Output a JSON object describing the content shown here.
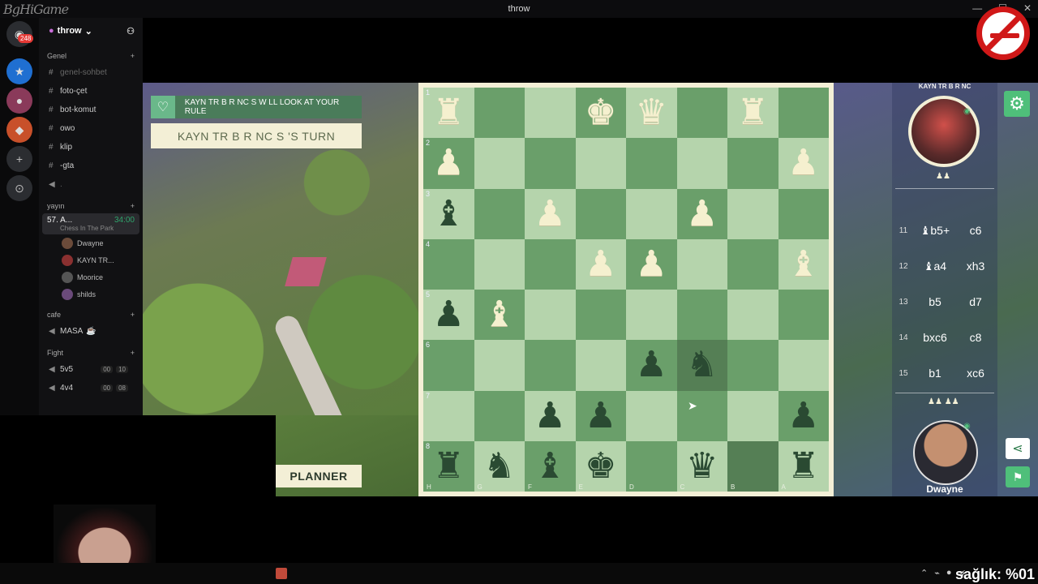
{
  "window": {
    "title": "throw",
    "overlay_logo": "BgHiGame",
    "health_text": "sağlık: %01"
  },
  "rail": {
    "badge": "248"
  },
  "server": {
    "name": "throw",
    "categories": {
      "genel": "Genel",
      "yayin": "yayın",
      "cafe": "cafe",
      "fight": "Fight"
    },
    "text_channels": [
      "genel-sohbet",
      "foto-çet",
      "bot-komut",
      "owo",
      "klip",
      "-gta"
    ],
    "voice_active": {
      "name": "57. A...",
      "timer": "34:00",
      "activity": "Chess In The Park"
    },
    "voice_users": [
      "Dwayne",
      "KAYN TR...",
      "Moorice",
      "shilds"
    ],
    "cafe_channels": [
      "MASA"
    ],
    "fight_channels": [
      {
        "name": "5v5",
        "a": "00",
        "b": "10"
      },
      {
        "name": "4v4",
        "a": "00",
        "b": "08"
      }
    ]
  },
  "game": {
    "notice": "KAYN TR B R NC S  W LL LOOK AT YOUR RULE",
    "turn": "KAYN TR B R NC S 'S TURN",
    "planner": "PLANNER",
    "top_player": "KAYN TR B R NC",
    "bottom_player": "Dwayne",
    "ranks": [
      "1",
      "2",
      "3",
      "4",
      "5",
      "6",
      "7",
      "8"
    ],
    "files": [
      "H",
      "G",
      "F",
      "E",
      "D",
      "C",
      "B",
      "A"
    ],
    "board": [
      [
        "w♜",
        "",
        "",
        "w♚",
        "w♛",
        "",
        "w♜",
        ""
      ],
      [
        "w♟",
        "",
        "",
        "",
        "",
        "",
        "",
        "w♟"
      ],
      [
        "b♝",
        "",
        "w♟",
        "",
        "",
        "w♟",
        "",
        ""
      ],
      [
        "",
        "",
        "",
        "w♟",
        "w♟",
        "",
        "",
        "w♝"
      ],
      [
        "b♟",
        "w♝",
        "",
        "",
        "",
        "",
        "",
        ""
      ],
      [
        "",
        "",
        "",
        "",
        "b♟",
        "b♞",
        "",
        ""
      ],
      [
        "",
        "",
        "b♟",
        "b♟",
        "",
        "",
        "",
        "b♟"
      ],
      [
        "b♜",
        "b♞",
        "b♝",
        "b♚",
        "",
        "b♛",
        "",
        "b♜"
      ]
    ],
    "moves": [
      {
        "n": "11",
        "w": "♝b5+",
        "b": "c6"
      },
      {
        "n": "12",
        "w": "♝a4",
        "b": "xh3"
      },
      {
        "n": "13",
        "w": "b5",
        "b": "d7"
      },
      {
        "n": "14",
        "w": "bxc6",
        "b": "c8"
      },
      {
        "n": "15",
        "w": "b1",
        "b": "xc6"
      }
    ]
  },
  "icons": {
    "gear": "gear-icon",
    "share": "share-icon",
    "flag": "flag-icon",
    "heart": "heart-icon"
  }
}
